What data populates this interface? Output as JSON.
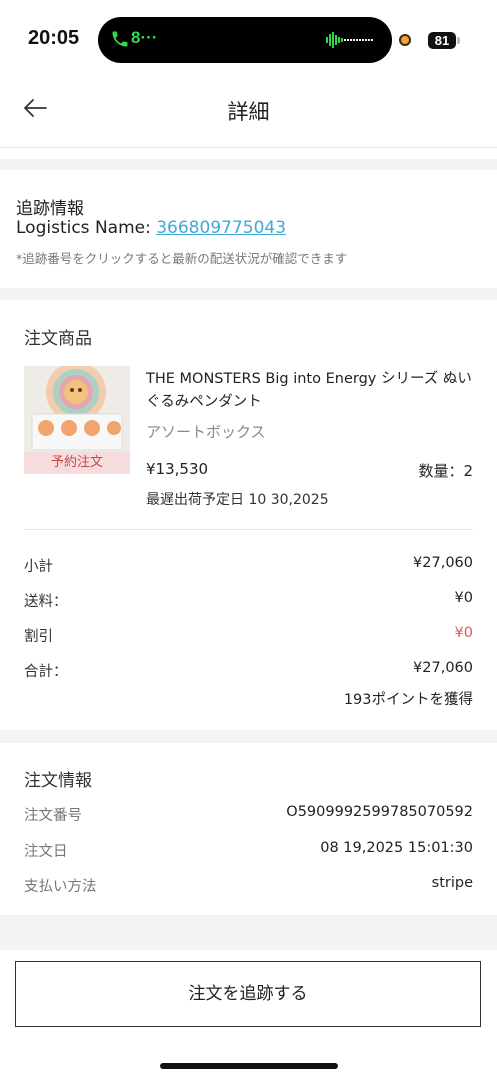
{
  "status_bar": {
    "time": "20:05",
    "call_text": "8···",
    "battery": "81"
  },
  "header": {
    "title": "詳細"
  },
  "tracking": {
    "title": "追跡情報",
    "logistics_label": "Logistics Name: ",
    "tracking_number": "366809775043",
    "note": "*追跡番号をクリックすると最新の配送状況が確認できます"
  },
  "order_items": {
    "title": "注文商品",
    "product": {
      "name": "THE MONSTERS Big into Energy シリーズ ぬいぐるみペンダント",
      "variant": "アソートボックス",
      "badge": "予約注文",
      "price": "¥13,530",
      "quantity": "数量：2",
      "ship_date": "最遅出荷予定日 10 30,2025"
    },
    "summary": [
      {
        "label": "小計",
        "value": "¥27,060"
      },
      {
        "label": "送料：",
        "value": "¥0"
      },
      {
        "label": "割引",
        "value": "¥0"
      },
      {
        "label": "合計：",
        "value": "¥27,060"
      }
    ],
    "points": "193ポイントを獲得"
  },
  "order_info": {
    "title": "注文情報",
    "rows": [
      {
        "label": "注文番号",
        "value": "O590999259978507059​2"
      },
      {
        "label": "注文日",
        "value": "08 19,2025 15:01:30"
      },
      {
        "label": "支払い方法",
        "value": "stripe"
      }
    ]
  },
  "bottom": {
    "track_button": "注文を追跡する"
  },
  "colors": {
    "link": "#3fa9d8",
    "discount": "#e05a5a",
    "badge_bg": "#f6dcdc",
    "badge_text": "#c54848",
    "section_gap": "#f3f3f3"
  }
}
